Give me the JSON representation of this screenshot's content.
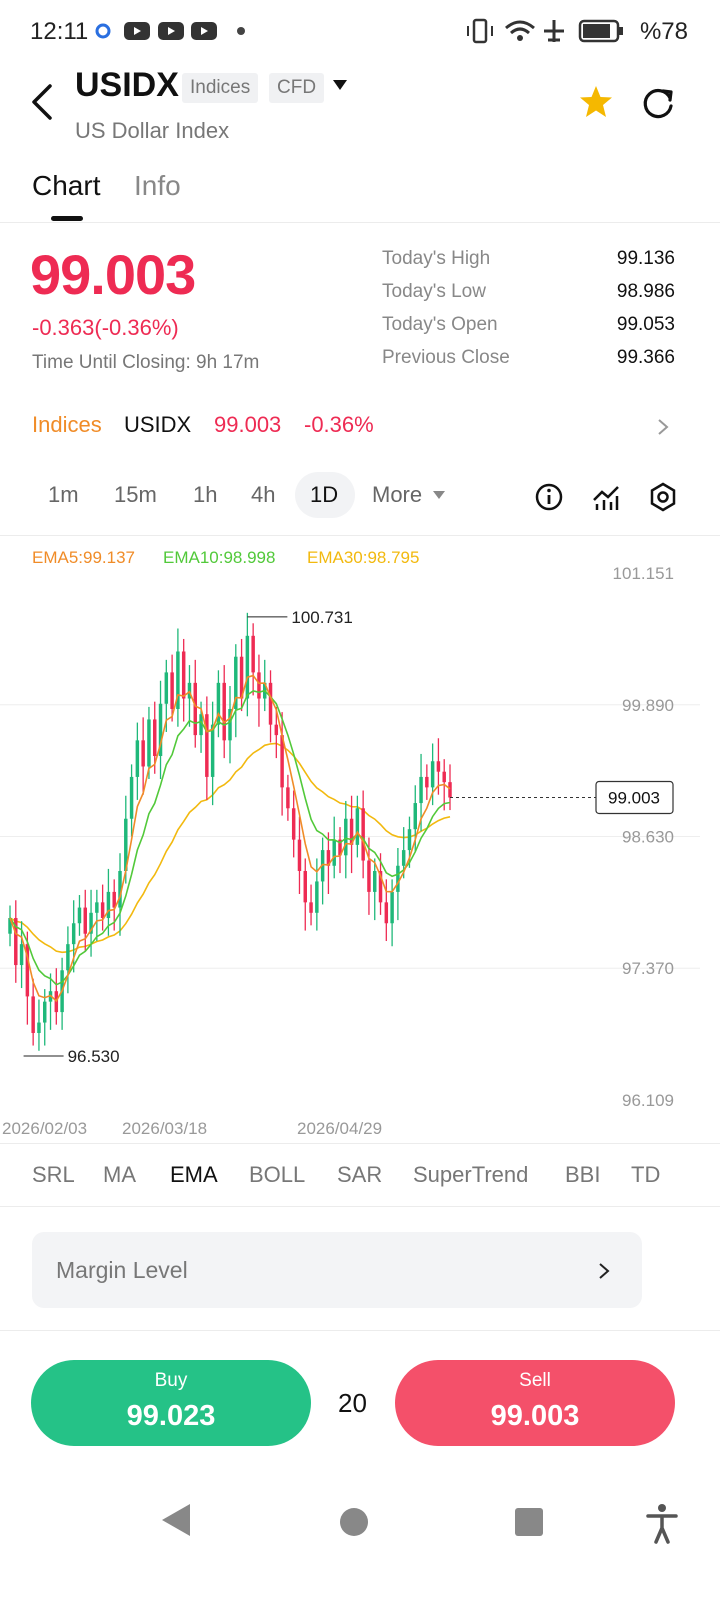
{
  "status_bar": {
    "time": "12:11",
    "battery": "%78"
  },
  "header": {
    "symbol": "USIDX",
    "tag_type": "Indices",
    "tag_product": "CFD",
    "subtitle": "US Dollar Index"
  },
  "tabs": [
    "Chart",
    "Info"
  ],
  "quote": {
    "price": "99.003",
    "change": "-0.363(-0.36%)",
    "closing": "Time Until Closing: 9h 17m",
    "stats": [
      {
        "label": "Today's High",
        "value": "99.136"
      },
      {
        "label": "Today's Low",
        "value": "98.986"
      },
      {
        "label": "Today's Open",
        "value": "99.053"
      },
      {
        "label": "Previous Close",
        "value": "99.366"
      }
    ]
  },
  "index_row": {
    "category": "Indices",
    "symbol": "USIDX",
    "price": "99.003",
    "change": "-0.36%"
  },
  "timeframes": [
    "1m",
    "15m",
    "1h",
    "4h",
    "1D",
    "More"
  ],
  "ema_legend": [
    "EMA5:99.137",
    "EMA10:98.998",
    "EMA30:98.795"
  ],
  "chart_data": {
    "type": "candlestick",
    "y_ticks": [
      "101.151",
      "99.890",
      "98.630",
      "97.370",
      "96.109"
    ],
    "ylim": [
      96.109,
      101.151
    ],
    "x_ticks": [
      "2026/02/03",
      "2026/03/18",
      "2026/04/29"
    ],
    "max_label": "100.731",
    "min_label": "96.530",
    "last_price": "99.003",
    "colors": {
      "up": "#1fb87a",
      "down": "#ee2b53",
      "ema5": "#f08c28",
      "ema10": "#52c93a",
      "ema30": "#f2b90f"
    }
  },
  "indicators": [
    "SRL",
    "MA",
    "EMA",
    "BOLL",
    "SAR",
    "SuperTrend",
    "BBI",
    "TD"
  ],
  "margin_label": "Margin Level",
  "trade": {
    "buy_label": "Buy",
    "buy_price": "99.023",
    "leverage": "20",
    "sell_label": "Sell",
    "sell_price": "99.003"
  }
}
